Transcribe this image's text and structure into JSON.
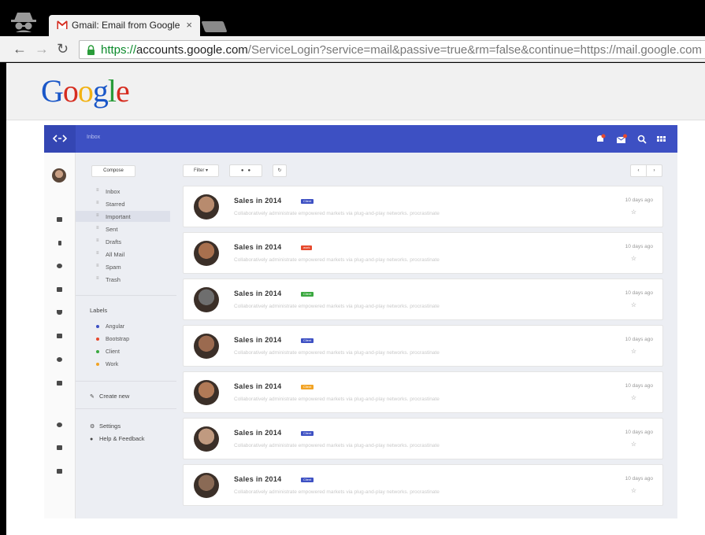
{
  "browser": {
    "tab_title": "Gmail: Email from Google",
    "tab_close": "×",
    "url_scheme": "https://",
    "url_host": "accounts.google.com",
    "url_path": "/ServiceLogin?service=mail&passive=true&rm=false&continue=https://mail.google.com",
    "back": "←",
    "forward": "→",
    "reload": "↻"
  },
  "logo": {
    "letters": [
      "G",
      "o",
      "o",
      "g",
      "l",
      "e"
    ],
    "colors": [
      "#1a57c8",
      "#d62d20",
      "#f2b213",
      "#1a57c8",
      "#2a9c3a",
      "#d62d20"
    ]
  },
  "app": {
    "breadcrumb": "Inbox",
    "accent": "#3d50c3",
    "compose_label": "Compose",
    "folders": [
      {
        "label": "Inbox",
        "active": false
      },
      {
        "label": "Starred",
        "active": false
      },
      {
        "label": "Important",
        "active": true
      },
      {
        "label": "Sent",
        "active": false
      },
      {
        "label": "Drafts",
        "active": false
      },
      {
        "label": "All Mail",
        "active": false
      },
      {
        "label": "Spam",
        "active": false
      },
      {
        "label": "Trash",
        "active": false
      }
    ],
    "labels_heading": "Labels",
    "labels": [
      {
        "label": "Angular",
        "color": "#3d50c3"
      },
      {
        "label": "Bootstrap",
        "color": "#e6492d"
      },
      {
        "label": "Client",
        "color": "#3aa83f"
      },
      {
        "label": "Work",
        "color": "#f2a324"
      }
    ],
    "create_new": "Create new",
    "settings": "Settings",
    "help": "Help & Feedback",
    "filter_label": "Filter ▾",
    "prev": "‹",
    "next": "›",
    "mails": [
      {
        "subject": "Sales in 2014",
        "tag": "Client",
        "tag_color": "#3d50c3",
        "preview": "Collaboratively administrate empowered markets via plug-and-play networks. procrastinate",
        "date": "10 days ago",
        "star": "☆",
        "face": "#b88b6e"
      },
      {
        "subject": "Sales in 2014",
        "tag": "work",
        "tag_color": "#e6492d",
        "preview": "Collaboratively administrate empowered markets via plug-and-play networks. procrastinate",
        "date": "10 days ago",
        "star": "☆",
        "face": "#a8704e"
      },
      {
        "subject": "Sales in 2014",
        "tag": "Client",
        "tag_color": "#3aa83f",
        "preview": "Collaboratively administrate empowered markets via plug-and-play networks. procrastinate",
        "date": "10 days ago",
        "star": "☆",
        "face": "#6e6e6e"
      },
      {
        "subject": "Sales in 2014",
        "tag": "Client",
        "tag_color": "#3d50c3",
        "preview": "Collaboratively administrate empowered markets via plug-and-play networks. procrastinate",
        "date": "10 days ago",
        "star": "☆",
        "face": "#9b6a4f"
      },
      {
        "subject": "Sales in 2014",
        "tag": "Client",
        "tag_color": "#f2a324",
        "preview": "Collaboratively administrate empowered markets via plug-and-play networks. procrastinate",
        "date": "10 days ago",
        "star": "☆",
        "face": "#b17a57"
      },
      {
        "subject": "Sales in 2014",
        "tag": "Client",
        "tag_color": "#3d50c3",
        "preview": "Collaboratively administrate empowered markets via plug-and-play networks. procrastinate",
        "date": "10 days ago",
        "star": "☆",
        "face": "#c09a80"
      },
      {
        "subject": "Sales in 2014",
        "tag": "Client",
        "tag_color": "#3d50c3",
        "preview": "Collaboratively administrate empowered markets via plug-and-play networks. procrastinate",
        "date": "10 days ago",
        "star": "☆",
        "face": "#8a6a55"
      }
    ]
  }
}
